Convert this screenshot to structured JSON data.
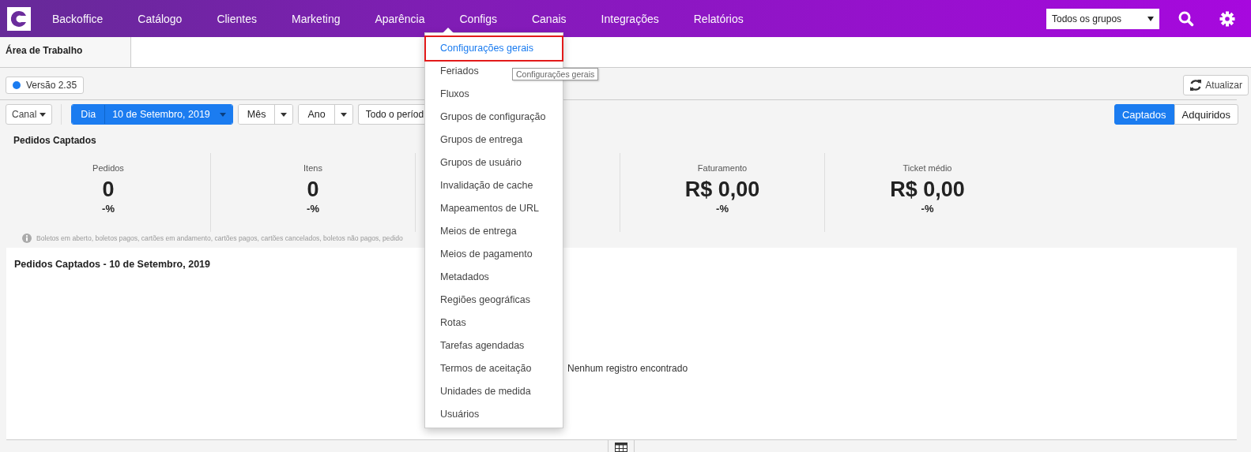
{
  "nav": {
    "items": [
      {
        "label": "Backoffice"
      },
      {
        "label": "Catálogo"
      },
      {
        "label": "Clientes"
      },
      {
        "label": "Marketing"
      },
      {
        "label": "Aparência"
      },
      {
        "label": "Configs"
      },
      {
        "label": "Canais"
      },
      {
        "label": "Integrações"
      },
      {
        "label": "Relatórios"
      }
    ],
    "group_select": {
      "value": "Todos os grupos"
    }
  },
  "tabs": [
    {
      "label": "Área de Trabalho"
    }
  ],
  "version_badge": {
    "label": "Versão 2.35",
    "color": "#1b7cf0"
  },
  "refresh_button": "Atualizar",
  "filters": {
    "channel": "Canal",
    "period_buttons": [
      {
        "label": "Dia",
        "value": "10 de Setembro, 2019",
        "selected": true
      },
      {
        "label": "Mês",
        "selected": false
      },
      {
        "label": "Ano",
        "selected": false
      }
    ],
    "all_period": "Todo o períod"
  },
  "mode_toggle": [
    {
      "label": "Captados",
      "selected": true
    },
    {
      "label": "Adquiridos",
      "selected": false
    }
  ],
  "summary": {
    "title": "Pedidos Captados",
    "kpis_left": [
      {
        "label": "Pedidos",
        "value": "0",
        "change": "-%"
      },
      {
        "label": "Itens",
        "value": "0",
        "change": "-%"
      }
    ],
    "kpis_right": [
      {
        "label": "Faturamento",
        "value": "R$ 0,00",
        "change": "-%"
      },
      {
        "label": "Ticket médio",
        "value": "R$ 0,00",
        "change": "-%"
      }
    ],
    "note": "Boletos em aberto, boletos pagos, cartões em andamento, cartões pagos, cartões cancelados, boletos não pagos, pedido"
  },
  "detail": {
    "title": "Pedidos Captados - 10 de Setembro, 2019",
    "empty_message": "Nenhum registro encontrado"
  },
  "configs_menu": {
    "items": [
      {
        "label": "Configurações gerais",
        "selected": true
      },
      {
        "label": "Feriados",
        "selected": false
      },
      {
        "label": "Fluxos",
        "selected": false
      },
      {
        "label": "Grupos de configuração",
        "selected": false
      },
      {
        "label": "Grupos de entrega",
        "selected": false
      },
      {
        "label": "Grupos de usuário",
        "selected": false
      },
      {
        "label": "Invalidação de cache",
        "selected": false
      },
      {
        "label": "Mapeamentos de URL",
        "selected": false
      },
      {
        "label": "Meios de entrega",
        "selected": false
      },
      {
        "label": "Meios de pagamento",
        "selected": false
      },
      {
        "label": "Metadados",
        "selected": false
      },
      {
        "label": "Regiões geográficas",
        "selected": false
      },
      {
        "label": "Rotas",
        "selected": false
      },
      {
        "label": "Tarefas agendadas",
        "selected": false
      },
      {
        "label": "Termos de aceitação",
        "selected": false
      },
      {
        "label": "Unidades de medida",
        "selected": false
      },
      {
        "label": "Usuários",
        "selected": false
      }
    ],
    "tooltip": "Configurações gerais"
  }
}
